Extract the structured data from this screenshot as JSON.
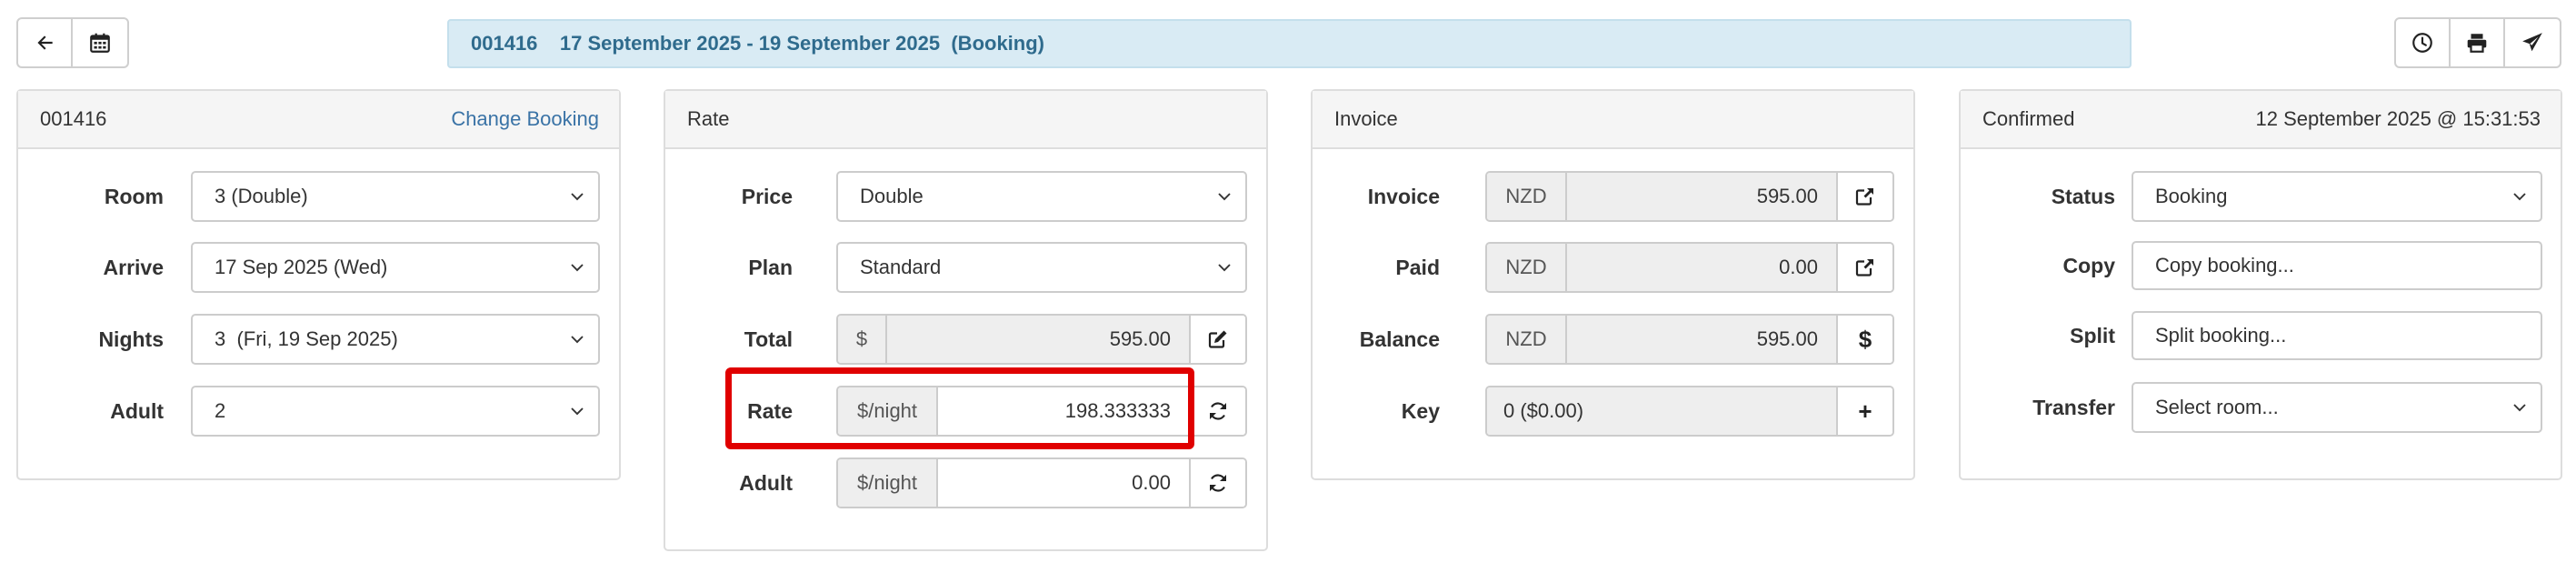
{
  "toolbar": {
    "left_icons": [
      "back-arrow-icon",
      "calendar-icon"
    ],
    "right_icons": [
      "clock-icon",
      "print-icon",
      "send-icon"
    ]
  },
  "title_bar": {
    "booking_id": "001416",
    "date_range": "17 September 2025 - 19 September 2025",
    "type": "(Booking)"
  },
  "booking_panel": {
    "header_id": "001416",
    "change_link": "Change Booking",
    "room_label": "Room",
    "room_value": "3 (Double)",
    "arrive_label": "Arrive",
    "arrive_value": "17 Sep 2025 (Wed)",
    "nights_label": "Nights",
    "nights_value": "3  (Fri, 19 Sep 2025)",
    "adult_label": "Adult",
    "adult_value": "2"
  },
  "rate_panel": {
    "header": "Rate",
    "price_label": "Price",
    "price_value": "Double",
    "plan_label": "Plan",
    "plan_value": "Standard",
    "total_label": "Total",
    "total_currency": "$",
    "total_value": "595.00",
    "rate_label": "Rate",
    "rate_unit": "$/night",
    "rate_value": "198.333333",
    "adult_label": "Adult",
    "adult_unit": "$/night",
    "adult_value": "0.00"
  },
  "invoice_panel": {
    "header": "Invoice",
    "invoice_label": "Invoice",
    "invoice_currency": "NZD",
    "invoice_value": "595.00",
    "paid_label": "Paid",
    "paid_currency": "NZD",
    "paid_value": "0.00",
    "balance_label": "Balance",
    "balance_currency": "NZD",
    "balance_value": "595.00",
    "balance_button": "$",
    "key_label": "Key",
    "key_value": "0 ($0.00)",
    "key_button": "+"
  },
  "status_panel": {
    "header_status": "Confirmed",
    "header_timestamp": "12 September 2025 @ 15:31:53",
    "status_label": "Status",
    "status_value": "Booking",
    "copy_label": "Copy",
    "copy_value": "Copy booking...",
    "split_label": "Split",
    "split_value": "Split booking...",
    "transfer_label": "Transfer",
    "transfer_value": "Select room..."
  },
  "colors": {
    "title_bg": "#d9ebf4",
    "title_text": "#2f6b8d",
    "link": "#3a73a6",
    "highlight": "#e00000"
  }
}
